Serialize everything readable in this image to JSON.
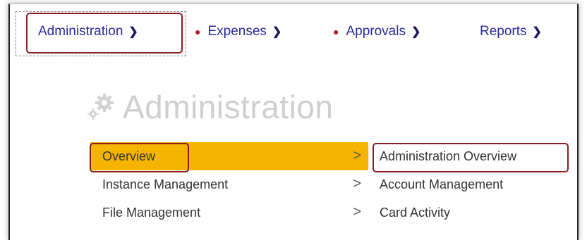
{
  "nav": {
    "items": [
      {
        "label": "Administration",
        "has_dot": false
      },
      {
        "label": "Expenses",
        "has_dot": true
      },
      {
        "label": "Approvals",
        "has_dot": true
      },
      {
        "label": "Reports",
        "has_dot": false
      }
    ],
    "chevron_icon": "chevron-down-icon",
    "dot_color": "#b21520"
  },
  "page": {
    "title": "Administration",
    "icon": "gears-icon"
  },
  "menu": {
    "items": [
      {
        "label": "Overview",
        "active": true
      },
      {
        "label": "Instance Management",
        "active": false
      },
      {
        "label": "File Management",
        "active": false
      }
    ],
    "active_color": "#f4b400"
  },
  "submenu": {
    "items": [
      {
        "label": "Administration Overview"
      },
      {
        "label": "Account Management"
      },
      {
        "label": "Card Activity"
      }
    ]
  },
  "annotation_color": "#8a1c24"
}
